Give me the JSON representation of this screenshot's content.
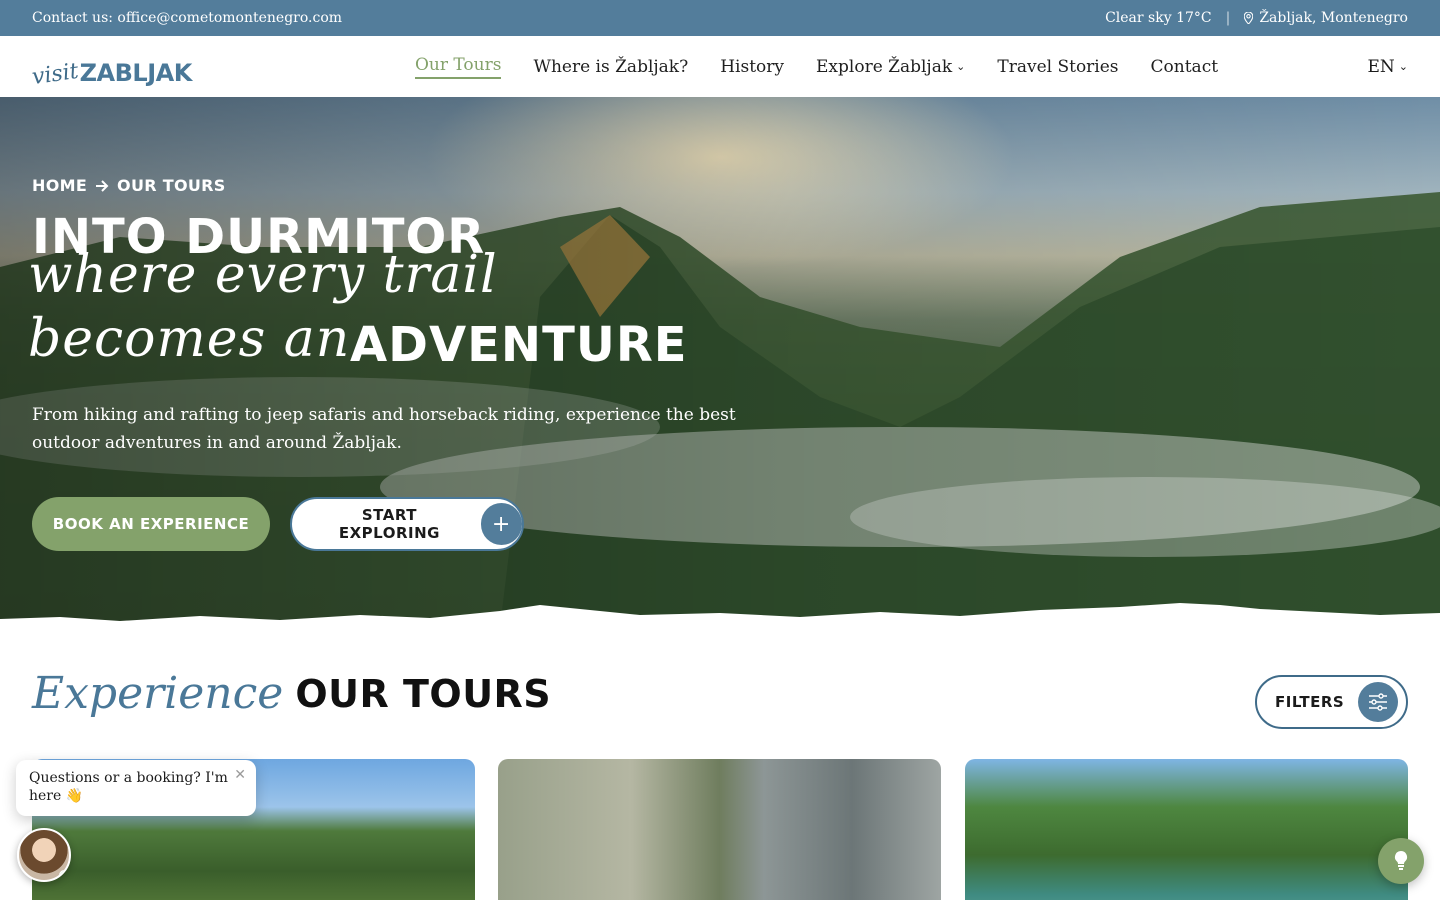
{
  "topbar": {
    "contact": "Contact us: office@cometomontenegro.com",
    "weather": "Clear sky 17°C",
    "separator": "|",
    "location": "Žabljak, Montenegro"
  },
  "header": {
    "logo_script": "visit",
    "logo_name": "ZABLJAK",
    "menu": [
      {
        "label": "Our Tours",
        "active": true
      },
      {
        "label": "Where is Žabljak?"
      },
      {
        "label": "History"
      },
      {
        "label": "Explore Žabljak",
        "dropdown": true
      },
      {
        "label": "Travel Stories"
      },
      {
        "label": "Contact"
      }
    ],
    "language": "EN"
  },
  "hero": {
    "breadcrumb": {
      "home": "HOME",
      "current": "OUR TOURS"
    },
    "title_line1": "INTO DURMITOR",
    "script_line1": "where every trail",
    "script_line2": "becomes an",
    "title_line2": "ADVENTURE",
    "description": "From hiking and rafting to jeep safaris and horseback riding, experience the best outdoor adventures in and around Žabljak.",
    "book_button": "BOOK AN EXPERIENCE",
    "explore_button": "START EXPLORING"
  },
  "tours": {
    "script": "Experience",
    "title": "OUR TOURS",
    "filters_button": "FILTERS"
  },
  "chat": {
    "message": "Questions or a booking? I'm here 👋"
  },
  "icons": {
    "location": "pin-icon",
    "arrow": "arrow-right-icon",
    "plus": "plus-icon",
    "filters": "sliders-icon",
    "close": "close-icon",
    "fab": "lightbulb-icon"
  },
  "colors": {
    "primary_blue": "#537d9b",
    "accent_green": "#84a26b",
    "text_dark": "#1b1b1b"
  }
}
